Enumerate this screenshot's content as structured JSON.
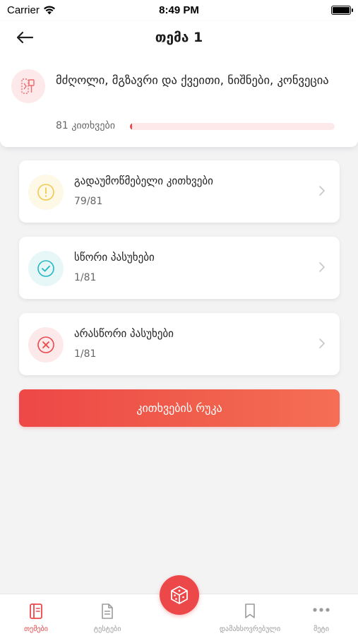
{
  "status_bar": {
    "carrier": "Carrier",
    "time": "8:49 PM"
  },
  "header": {
    "title": "თემა 1"
  },
  "topic": {
    "title": "მძღოლი, მგზავრი და ქვეითი, ნიშნები, კონვეცია",
    "count_label": "81 კითხვები",
    "progress": 0.01,
    "icon": "road-signs-icon"
  },
  "stats": [
    {
      "label": "გადაუმოწმებელი კითხვები",
      "value": "79/81",
      "icon": "exclamation-circle-icon",
      "color": "#f2c94c",
      "bg": "#fef8e6"
    },
    {
      "label": "სწორი პასუხები",
      "value": "1/81",
      "icon": "check-circle-icon",
      "color": "#20b8c4",
      "bg": "#e7f7f8"
    },
    {
      "label": "არასწორი პასუხები",
      "value": "1/81",
      "icon": "x-circle-icon",
      "color": "#ec4749",
      "bg": "#fde9ea"
    }
  ],
  "primary_button": {
    "label": "კითხვების რუკა"
  },
  "tabs": [
    {
      "label": "თემები",
      "icon": "book-icon",
      "active": true
    },
    {
      "label": "ტესტები",
      "icon": "document-icon",
      "active": false
    },
    {
      "label": "დამახსოვრებული",
      "icon": "bookmark-icon",
      "active": false
    },
    {
      "label": "მეტი",
      "icon": "more-dots-icon",
      "active": false
    }
  ],
  "center_tab": {
    "icon": "dice-icon"
  },
  "colors": {
    "accent": "#ec4749",
    "background": "#f3f3f4"
  }
}
